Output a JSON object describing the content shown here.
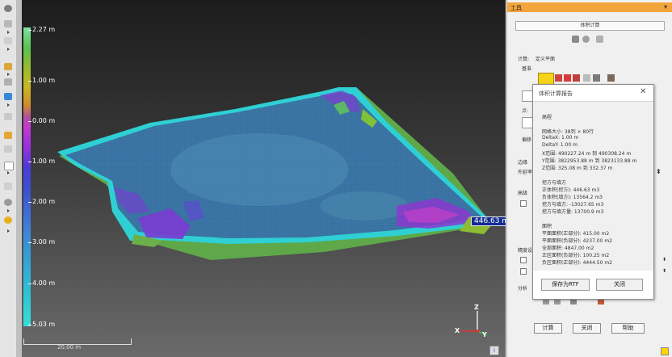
{
  "colorbar": {
    "labels": [
      "2.27 m",
      "1.00 m",
      "0.00 m",
      "1.00 m",
      "2.00 m",
      "3.00 m",
      "4.00 m",
      "5.03 m"
    ]
  },
  "viewport": {
    "volume_label": "446.63 m3",
    "scale_label": "20.00 m",
    "axes": {
      "z": "Z",
      "x": "X",
      "y": "Y"
    }
  },
  "panel": {
    "title": "工具",
    "section_title": "体积计算",
    "label_calc": "计算:",
    "value_calc": "定义平面",
    "label_plane": "基准",
    "label_point": "点:",
    "label_dir": "偏移",
    "label_s1": "边缘",
    "label_s2": "外延率",
    "label_s3": "高级",
    "label_s4": "精度设置",
    "label_s5": "分析",
    "buttons": {
      "calc": "计算",
      "close": "关闭",
      "help": "帮助"
    }
  },
  "dialog": {
    "title": "体积计算报告",
    "lines": [
      "高程",
      "网格大小: 38列 × 80行",
      "DeltaX: 1.00 m",
      "DeltaY: 1.00 m",
      "X范围: 490227.24 m 到 490308.24 m",
      "Y范围: 3822953.88 m 到 3823133.88 m",
      "Z范围: 325.08 m 到 332.37 m",
      "挖方与填方",
      "正体积(挖方): 446.63 m3",
      "负体积(填方): 13564.2 m3",
      "挖方与填方: -13027.65 m3",
      "挖方与填方量: 13700.9 m3",
      "面积",
      "平面面积(正部分): 415.00 m2",
      "平面面积(负部分): 4237.00 m2",
      "全部面积: 4847.00 m2",
      "正区面积(负部分): 100.25 m2",
      "负区面积(正部分): 4444.50 m2"
    ],
    "save_button": "保存为RTF",
    "close_button": "关闭"
  }
}
